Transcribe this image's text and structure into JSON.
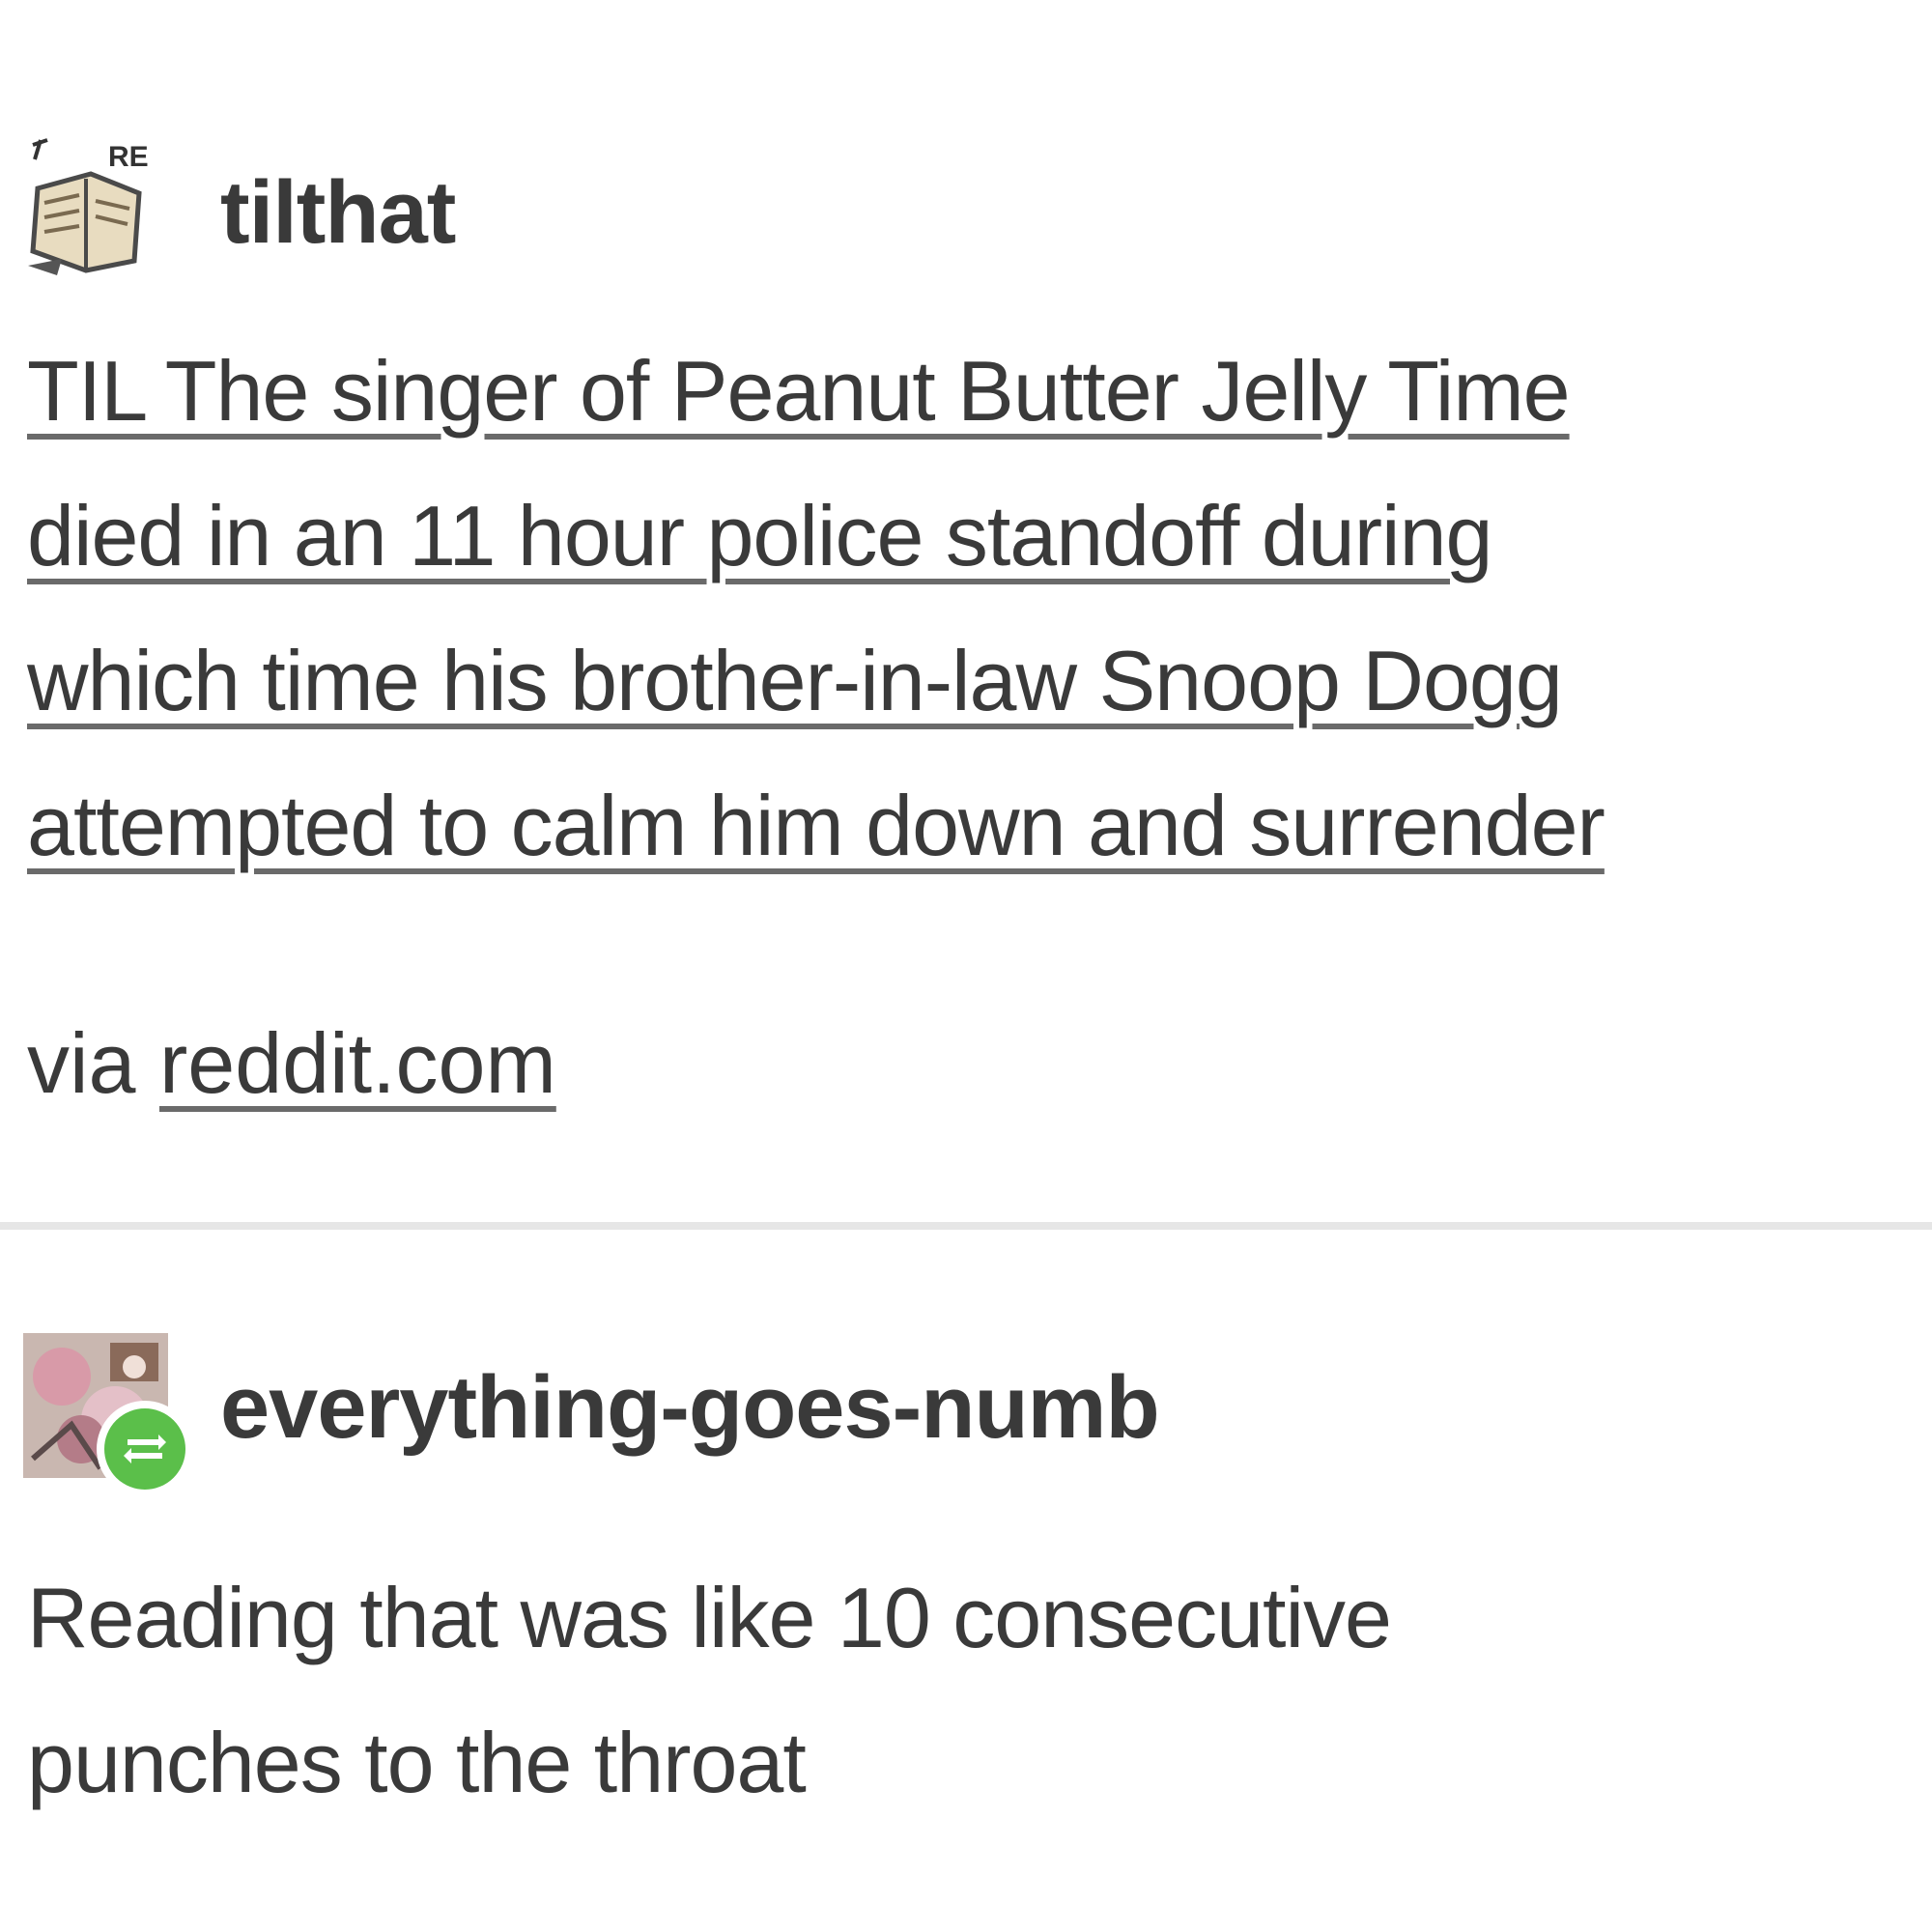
{
  "posts": [
    {
      "username": "tilthat",
      "avatar_icon": "book-with-writing-avatar-icon",
      "link_lines": [
        "TIL The singer of Peanut Butter Jelly Time",
        "died in an 11 hour police standoff during",
        "which time his brother-in-law Snoop Dogg",
        "attempted to calm him down and surrender"
      ],
      "source_prefix": "via",
      "source_link": "reddit.com"
    },
    {
      "username": "everything-goes-numb",
      "avatar_icon": "collage-avatar-icon",
      "badge_icon": "reblog-icon",
      "badge_color": "#5bbf4a",
      "text_lines": [
        "Reading that was like 10 consecutive",
        "punches to the throat"
      ]
    }
  ]
}
